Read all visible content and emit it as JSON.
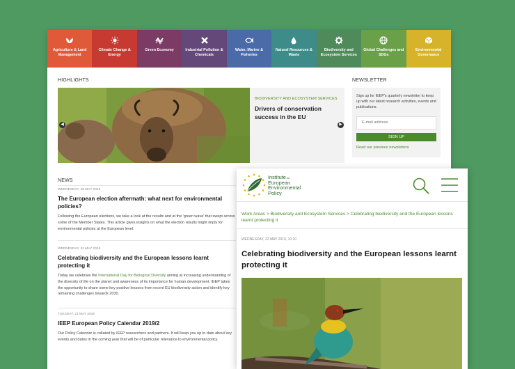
{
  "nav": [
    {
      "label": "Agriculture & Land Management",
      "icon": "leaf-icon",
      "color": "#e05a3a"
    },
    {
      "label": "Climate Change & Energy",
      "icon": "sun-icon",
      "color": "#c63a32"
    },
    {
      "label": "Green Economy",
      "icon": "wave-icon",
      "color": "#7b3b64"
    },
    {
      "label": "Industrial Pollution & Chemicals",
      "icon": "x-icon",
      "color": "#65487a"
    },
    {
      "label": "Water, Marine & Fisheries",
      "icon": "fish-icon",
      "color": "#4a6aa8"
    },
    {
      "label": "Natural Resources & Waste",
      "icon": "drop-icon",
      "color": "#3d8c8a"
    },
    {
      "label": "Biodiversity and Ecosystem Services",
      "icon": "gear-icon",
      "color": "#4f8a5a"
    },
    {
      "label": "Global Challenges and SDGs",
      "icon": "globe-icon",
      "color": "#6aa048"
    },
    {
      "label": "Environmental Governance",
      "icon": "cube-icon",
      "color": "#d6b32a"
    }
  ],
  "highlights": {
    "title": "HIGHLIGHTS",
    "category": "BIODIVERSITY AND ECOSYSTEM SERVICES",
    "headline": "Drivers of conservation success in the EU"
  },
  "newsletter": {
    "title": "NEWSLETTER",
    "text": "Sign up for IEEP's quarterly newsletter to keep up with our latest research activities, events and publications.",
    "placeholder": "E-mail address",
    "button": "SIGN UP",
    "link": "Read our previous newsletters"
  },
  "news": {
    "title": "NEWS",
    "items": [
      {
        "date": "WEDNESDAY, 29 MAY 2019",
        "headline": "The European election aftermath: what next for environmental policies?",
        "body": "Following the European elections, we take a look at the results and at the 'green wave' that swept across some of the Member States. This article gives insights on what the election results might imply for environmental policies at the European level."
      },
      {
        "date": "WEDNESDAY, 22 MAY 2019",
        "headline": "Celebrating biodiversity and the European lessons learnt protecting it",
        "body_pre": "Today we celebrate the ",
        "body_link": "International Day for Biological Diversity",
        "body_post": " aiming at increasing understanding of the diversity of life on the planet and awareness of its importance for human development. IEEP takes the opportunity to share some key positive lessons from recent EU biodiversity action and identify key remaining challenges towards 2030."
      },
      {
        "date": "TUESDAY, 21 MAY 2019",
        "headline": "IEEP European Policy Calendar 2019/2",
        "body": "Our Policy Calendar is collated by IEEP researchers and partners. It will keep you up to date about key events and dates in the coming year that will be of particular relevance to environmental policy."
      }
    ]
  },
  "mobile": {
    "brand_line1": "Institute",
    "brand_for": "for",
    "brand_line2": "European",
    "brand_line3": "Environmental",
    "brand_line4": "Policy",
    "crumbs": [
      "Work Areas",
      "Biodiversity and Ecosystem Services",
      "Celebrating biodiversity and the European lessons learnt protecting it"
    ],
    "crumb_sep": ">",
    "date": "WEDNESDAY, 22 MAY 2019, 10:10",
    "title": "Celebrating biodiversity and the European lessons learnt protecting it"
  }
}
